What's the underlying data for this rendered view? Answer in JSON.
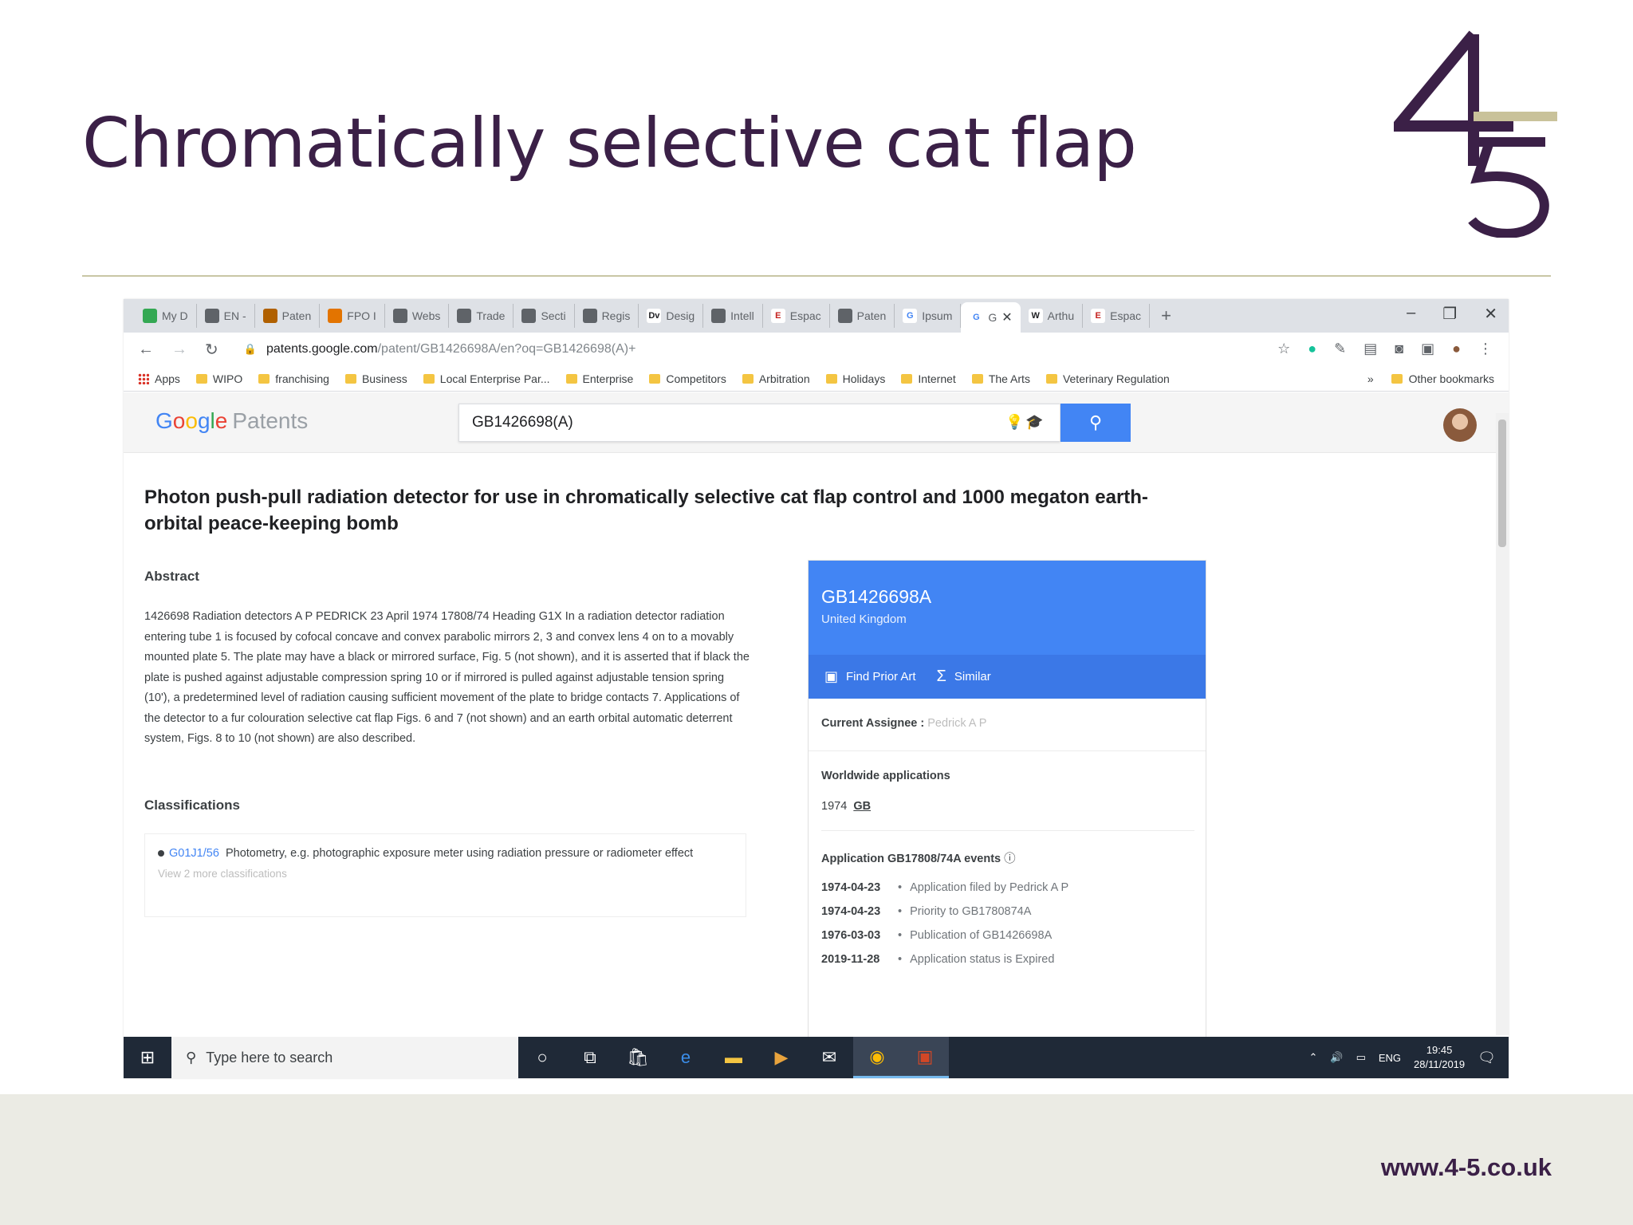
{
  "slide": {
    "title": "Chromatically selective cat flap",
    "footer_url": "www.4-5.co.uk",
    "logo_text": "4-5"
  },
  "browser": {
    "tabs": [
      {
        "label": "My D",
        "icon": "drive-icon"
      },
      {
        "label": "EN -",
        "icon": "globe-icon"
      },
      {
        "label": "Paten",
        "icon": "people-icon"
      },
      {
        "label": "FPO I",
        "icon": "fpo-icon"
      },
      {
        "label": "Webs",
        "icon": "doc-icon"
      },
      {
        "label": "Trade",
        "icon": "doc-icon"
      },
      {
        "label": "Secti",
        "icon": "doc-icon"
      },
      {
        "label": "Regis",
        "icon": "doc-icon"
      },
      {
        "label": "Desig",
        "icon": "dv-icon"
      },
      {
        "label": "Intell",
        "icon": "bug-icon"
      },
      {
        "label": "Espac",
        "icon": "espacenet-icon"
      },
      {
        "label": "Paten",
        "icon": "doc-icon"
      },
      {
        "label": "Ipsum",
        "icon": "google-icon"
      },
      {
        "label": "G",
        "icon": "google-icon",
        "active": true
      },
      {
        "label": "Arthu",
        "icon": "wikipedia-icon"
      },
      {
        "label": "Espac",
        "icon": "espacenet-icon"
      }
    ],
    "url_host": "patents.google.com",
    "url_path": "/patent/GB1426698A/en?oq=GB1426698(A)+",
    "bookmarks": [
      "Apps",
      "WIPO",
      "franchising",
      "Business",
      "Local Enterprise Par...",
      "Enterprise",
      "Competitors",
      "Arbitration",
      "Holidays",
      "Internet",
      "The Arts",
      "Veterinary Regulation"
    ],
    "other_bookmarks": "Other bookmarks",
    "overflow": "»"
  },
  "patents_page": {
    "logo_google": "Google",
    "logo_patents": "Patents",
    "search_value": "GB1426698(A)",
    "title": "Photon push-pull radiation detector for use in chromatically selective cat flap control and 1000 megaton earth-orbital peace-keeping bomb",
    "abstract_heading": "Abstract",
    "abstract_text": "1426698 Radiation detectors A P PEDRICK 23 April 1974 17808/74 Heading G1X In a radiation detector radiation entering tube 1 is focused by cofocal concave and convex parabolic mirrors 2, 3 and convex lens 4 on to a movably mounted plate 5. The plate may have a black or mirrored surface, Fig. 5 (not shown), and it is asserted that if black the plate is pushed against adjustable compression spring 10 or if mirrored is pulled against adjustable tension spring (10'), a predetermined level of radiation causing sufficient movement of the plate to bridge contacts 7. Applications of the detector to a fur colouration selective cat flap Figs. 6 and 7 (not shown) and an earth orbital automatic deterrent system, Figs. 8 to 10 (not shown) are also described.",
    "classifications_heading": "Classifications",
    "class_code": "G01J1/56",
    "class_desc": "Photometry, e.g. photographic exposure meter using radiation pressure or radiometer effect",
    "more_classifications": "View 2 more classifications",
    "card": {
      "patent_number": "GB1426698A",
      "country": "United Kingdom",
      "find_prior_art": "Find Prior Art",
      "similar": "Similar",
      "assignee_label": "Current Assignee :",
      "assignee_value": "Pedrick A P",
      "worldwide_heading": "Worldwide applications",
      "worldwide_year": "1974",
      "worldwide_country": "GB",
      "events_heading": "Application GB17808/74A events",
      "events": [
        {
          "date": "1974-04-23",
          "text": "Application filed by Pedrick A P"
        },
        {
          "date": "1974-04-23",
          "text": "Priority to GB1780874A"
        },
        {
          "date": "1976-03-03",
          "text": "Publication of GB1426698A"
        },
        {
          "date": "2019-11-28",
          "text": "Application status is Expired"
        }
      ]
    }
  },
  "taskbar": {
    "search_placeholder": "Type here to search",
    "lang": "ENG",
    "time": "19:45",
    "date": "28/11/2019"
  },
  "colors": {
    "title_purple": "#3b2047",
    "google_blue": "#4285f4",
    "logo_gold": "#c9c29a"
  }
}
